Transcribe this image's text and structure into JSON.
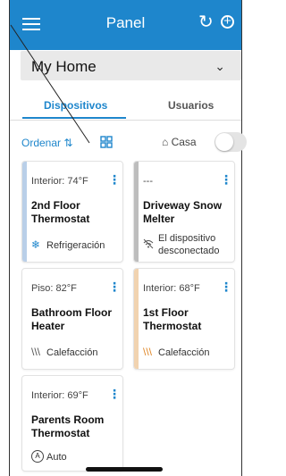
{
  "header": {
    "title": "Panel",
    "menu_icon": "hamburger-menu-icon",
    "refresh_icon": "refresh-icon",
    "add_icon": "add-circle-icon",
    "color": "#1e86cc"
  },
  "home_selector": {
    "value": "My Home"
  },
  "tabs": [
    {
      "label": "Dispositivos",
      "active": true
    },
    {
      "label": "Usuarios",
      "active": false
    }
  ],
  "toolbar": {
    "sort_label": "Ordenar",
    "sort_icon": "sort-arrows-icon",
    "view_icon": "grid-view-icon",
    "home_mode_label": "Casa",
    "home_mode_on": false
  },
  "devices": [
    {
      "reading": "Interior: 74°F",
      "name": "2nd Floor Thermostat",
      "mode": "Refrigeración",
      "mode_icon": "snowflake-icon",
      "accent": "#b9cfe8"
    },
    {
      "reading": "---",
      "name": "Driveway Snow Melter",
      "mode": "El dispositivo desconectado",
      "mode_icon": "wifi-off-icon",
      "accent": "#bdbdbd"
    },
    {
      "reading": "Piso: 82°F",
      "name": "Bathroom Floor Heater",
      "mode": "Calefacción",
      "mode_icon": "heat-waves-icon",
      "accent": ""
    },
    {
      "reading": "Interior: 68°F",
      "name": "1st Floor Thermostat",
      "mode": "Calefacción",
      "mode_icon": "heat-waves-icon",
      "accent": "#f1d3b0"
    },
    {
      "reading": "Interior: 69°F",
      "name": "Parents Room Thermostat",
      "mode": "Auto",
      "mode_icon": "auto-mode-icon",
      "accent": ""
    }
  ]
}
